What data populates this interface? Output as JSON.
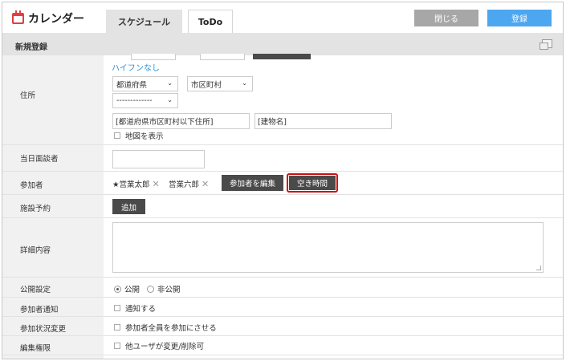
{
  "app": {
    "title": "カレンダー"
  },
  "tabs": [
    {
      "label": "スケジュール",
      "active": true
    },
    {
      "label": "ToDo",
      "active": false
    }
  ],
  "toolbar": {
    "close_label": "閉じる",
    "register_label": "登録"
  },
  "header": {
    "title": "新規登録"
  },
  "address": {
    "label": "住所",
    "no_hyphen_link": "ハイフンなし",
    "prefecture_select": "都道府県",
    "city_select": "市区町村",
    "district_select": "-------------",
    "street_value": "[都道府県市区町村以下住所]",
    "building_value": "[建物名]",
    "show_map_label": "地図を表示"
  },
  "interviewer": {
    "label": "当日面談者",
    "value": ""
  },
  "participants": {
    "label": "参加者",
    "list": [
      {
        "name": "★営業太郎"
      },
      {
        "name": "営業六郎"
      }
    ],
    "remove_glyph": "✕",
    "edit_button": "参加者を編集",
    "free_time_button": "空き時間"
  },
  "facility": {
    "label": "施設予約",
    "add_button": "追加"
  },
  "details": {
    "label": "詳細内容",
    "value": ""
  },
  "visibility": {
    "label": "公開設定",
    "options": [
      {
        "label": "公開",
        "selected": true
      },
      {
        "label": "非公開",
        "selected": false
      }
    ]
  },
  "notify": {
    "label": "参加者通知",
    "option": "通知する"
  },
  "status_change": {
    "label": "参加状況変更",
    "option": "参加者全員を参加にさせる"
  },
  "edit_permission": {
    "label": "編集権限",
    "option": "他ユーザが変更/削除可"
  },
  "colors": {
    "accent": "#4da6f0",
    "brand_red": "#e04040",
    "highlight": "#cc1111",
    "dark_button": "#4a4a4a"
  }
}
